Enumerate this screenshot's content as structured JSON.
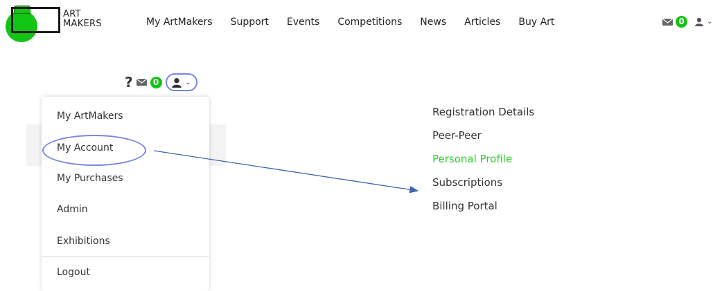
{
  "logo": {
    "line1": "ART",
    "line2": "MAKERS"
  },
  "nav": [
    "My ArtMakers",
    "Support",
    "Events",
    "Competitions",
    "News",
    "Articles",
    "Buy Art"
  ],
  "top_right": {
    "message_count": "0"
  },
  "mid_toolbar": {
    "help_glyph": "?",
    "message_count": "0"
  },
  "dropdown": {
    "items": [
      "My ArtMakers",
      "My Account",
      "My Purchases",
      "Admin",
      "Exhibitions"
    ],
    "logout": "Logout"
  },
  "account_menu": {
    "items": [
      "Registration Details",
      "Peer-Peer",
      "Personal Profile",
      "Subscriptions",
      "Billing Portal"
    ],
    "active_index": 2
  },
  "colors": {
    "accent_green": "#13c413",
    "active_link": "#33cc33",
    "highlight_ring": "#7c86e0",
    "arrow": "#3d62b0"
  },
  "icons": [
    "envelope-icon",
    "user-icon",
    "chevron-down-icon",
    "question-icon"
  ]
}
